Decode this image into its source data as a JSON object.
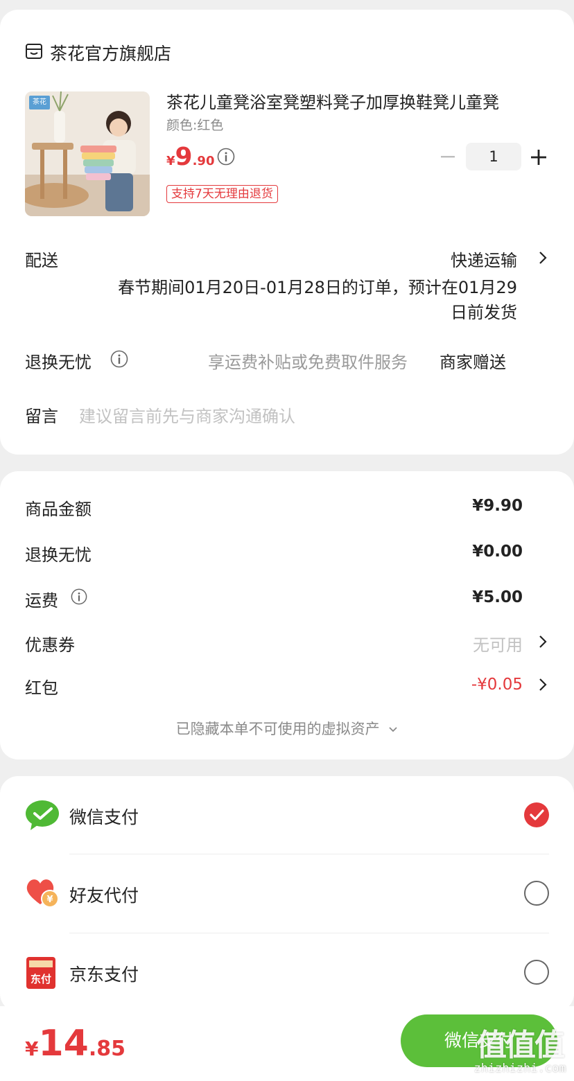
{
  "store": {
    "name": "茶花官方旗舰店",
    "icon": "store-icon"
  },
  "product": {
    "title": "茶花儿童凳浴室凳塑料凳子加厚换鞋凳儿童凳",
    "spec": "颜色:红色",
    "brand_badge": "茶花",
    "price_symbol": "¥",
    "price_int": "9",
    "price_dec": ".90",
    "quantity": "1",
    "return_tag": "支持7天无理由退货"
  },
  "delivery": {
    "label": "配送",
    "method": "快递运输",
    "note_line1": "春节期间01月20日-01月28日的订单，预计在01月29",
    "note_line2": "日前发货"
  },
  "return_service": {
    "label": "退换无忧",
    "desc": "享运费补贴或免费取件服务",
    "value": "商家赠送"
  },
  "message": {
    "label": "留言",
    "placeholder": "建议留言前先与商家沟通确认"
  },
  "summary": {
    "goods_label": "商品金额",
    "goods_value": "¥9.90",
    "return_label": "退换无忧",
    "return_value": "¥0.00",
    "shipping_label": "运费",
    "shipping_value": "¥5.00",
    "coupon_label": "优惠券",
    "coupon_value": "无可用",
    "redpacket_label": "红包",
    "redpacket_value": "-¥0.05",
    "hidden_note": "已隐藏本单不可使用的虚拟资产"
  },
  "payment": {
    "options": [
      {
        "label": "微信支付",
        "icon": "wechat-pay-icon",
        "selected": true
      },
      {
        "label": "好友代付",
        "icon": "friend-pay-icon",
        "selected": false
      },
      {
        "label": "京东支付",
        "icon": "jd-pay-icon",
        "selected": false
      }
    ],
    "jd_icon_text": "东付"
  },
  "footer": {
    "total_symbol": "¥",
    "total_int": "14",
    "total_dec": ".85",
    "pay_button": "微信支付",
    "watermark": "值值值",
    "watermark_url": "zhizhizhi.com"
  },
  "colors": {
    "accent": "#e4393c",
    "wechat_green": "#5cbf3a",
    "background": "#efefef"
  }
}
